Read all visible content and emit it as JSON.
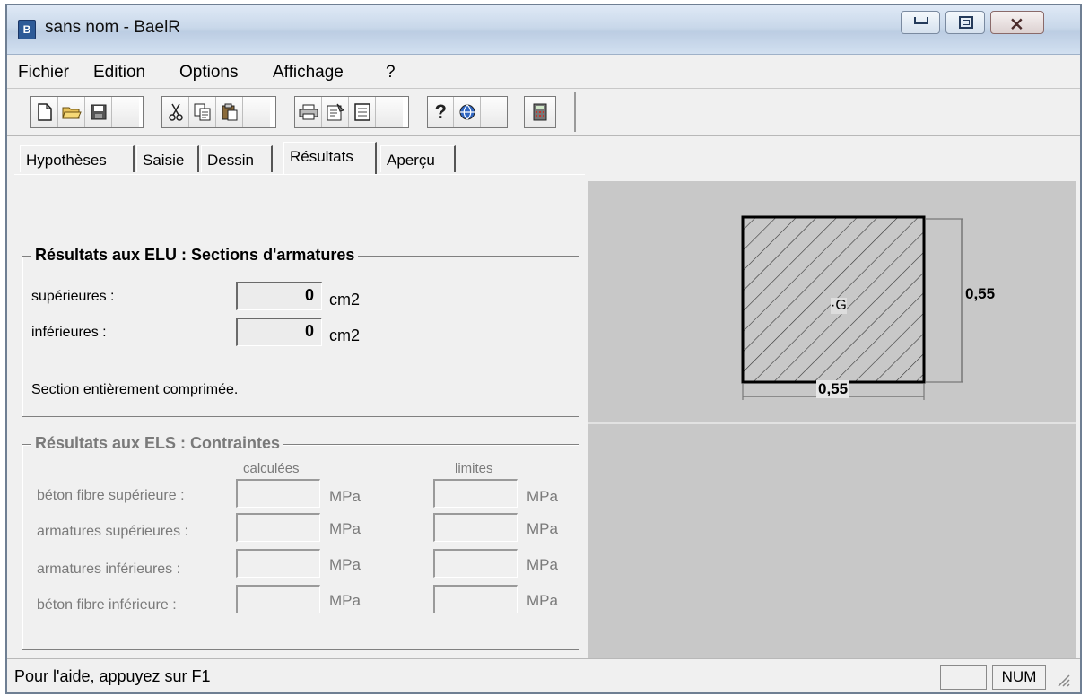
{
  "window": {
    "title": "sans nom - BaelR",
    "close_glyph": "⨯"
  },
  "menu": [
    "Fichier",
    "Edition",
    "Options",
    "Affichage",
    "?"
  ],
  "toolbar": {
    "icons": [
      "new-document-icon",
      "open-folder-icon",
      "save-icon",
      "cut-icon",
      "copy-icon",
      "paste-icon",
      "print-icon",
      "properties-icon",
      "notes-icon",
      "help-icon",
      "globe-icon",
      "calculator-icon"
    ],
    "help_glyph": "?"
  },
  "tabs": [
    "Hypothèses",
    "Saisie",
    "Dessin",
    "Résultats",
    "Aperçu"
  ],
  "active_tab": "Résultats",
  "elu": {
    "title": "Résultats aux ELU : Sections d'armatures",
    "rows": [
      {
        "label": "supérieures :",
        "value": "0",
        "unit": "cm2"
      },
      {
        "label": "inférieures :",
        "value": "0",
        "unit": "cm2"
      }
    ],
    "message": "Section entièrement comprimée."
  },
  "els": {
    "title": "Résultats aux ELS : Contraintes",
    "col_calculees": "calculées",
    "col_limites": "limites",
    "rows": [
      {
        "label": "béton fibre supérieure :",
        "unit": "MPa"
      },
      {
        "label": "armatures supérieures :",
        "unit": "MPa"
      },
      {
        "label": "armatures inférieures :",
        "unit": "MPa"
      },
      {
        "label": "béton fibre inférieure :",
        "unit": "MPa"
      }
    ]
  },
  "drawing": {
    "height_label": "0,55",
    "width_label": "0,55",
    "centroid_label": "G"
  },
  "statusbar": {
    "help_text": "Pour l'aide, appuyez sur F1",
    "num_indicator": "NUM"
  }
}
